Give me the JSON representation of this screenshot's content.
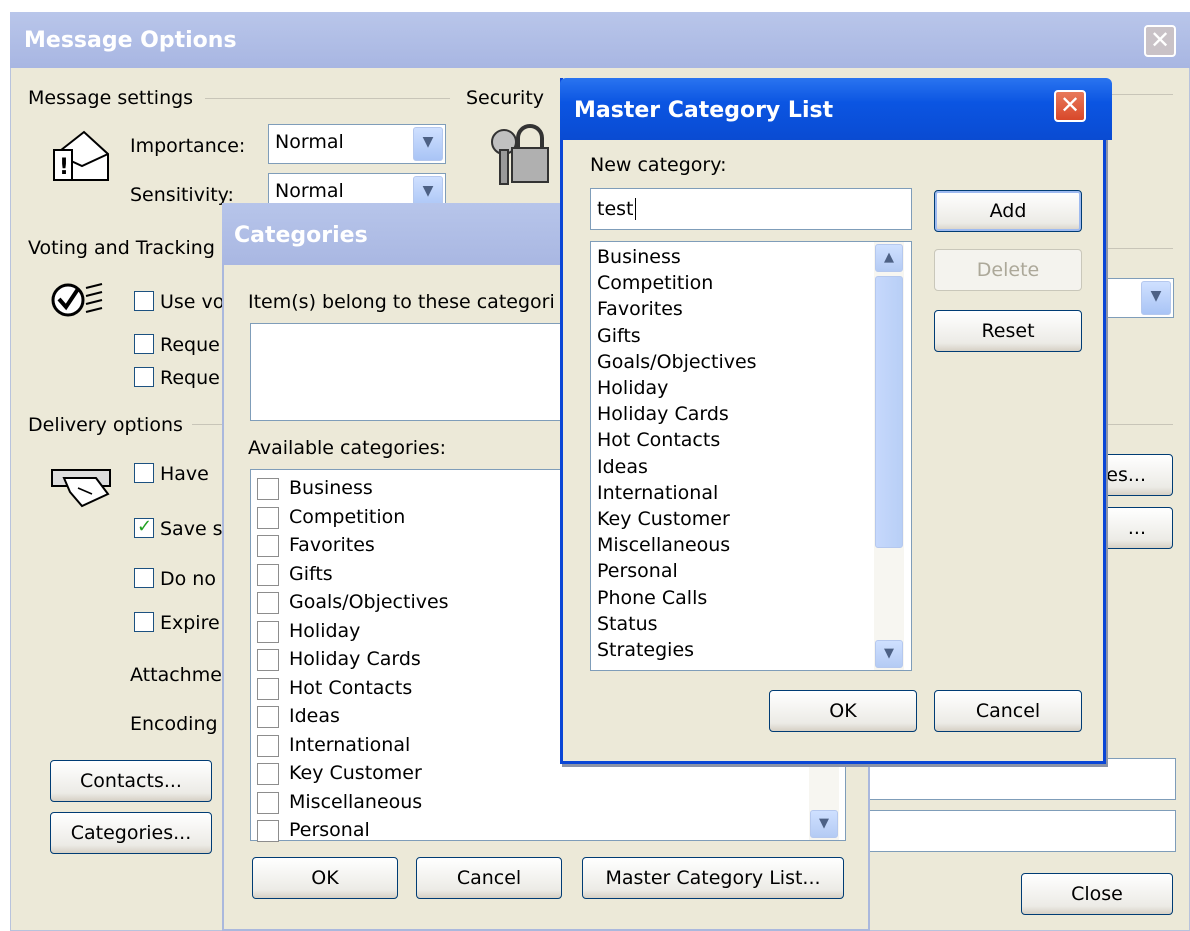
{
  "message_options": {
    "title": "Message Options",
    "message_settings": {
      "legend": "Message settings",
      "importance_label": "Importance:",
      "importance_value": "Normal",
      "sensitivity_label": "Sensitivity:",
      "sensitivity_value": "Normal"
    },
    "security_legend": "Security",
    "voting_legend": "Voting and Tracking",
    "voting_checks": [
      "Use vo",
      "Reque",
      "Reque"
    ],
    "delivery_legend": "Delivery options",
    "delivery_checks": [
      "Have",
      "Save s",
      "Do no",
      "Expire"
    ],
    "attachments_label": "Attachme",
    "encoding_label": "Encoding",
    "contacts_button": "Contacts...",
    "categories_button": "Categories...",
    "partial_button_1": "es...",
    "partial_button_2": "...",
    "close_button": "Close"
  },
  "categories_dialog": {
    "title": "Categories",
    "belongs_label": "Item(s) belong to these categori",
    "available_label": "Available categories:",
    "items": [
      "Business",
      "Competition",
      "Favorites",
      "Gifts",
      "Goals/Objectives",
      "Holiday",
      "Holiday Cards",
      "Hot Contacts",
      "Ideas",
      "International",
      "Key Customer",
      "Miscellaneous",
      "Personal"
    ],
    "ok": "OK",
    "cancel": "Cancel",
    "master_list_button": "Master Category List..."
  },
  "master_dialog": {
    "title": "Master Category List",
    "new_category_label": "New category:",
    "new_category_value": "test",
    "add": "Add",
    "delete": "Delete",
    "reset": "Reset",
    "items": [
      "Business",
      "Competition",
      "Favorites",
      "Gifts",
      "Goals/Objectives",
      "Holiday",
      "Holiday Cards",
      "Hot Contacts",
      "Ideas",
      "International",
      "Key Customer",
      "Miscellaneous",
      "Personal",
      "Phone Calls",
      "Status",
      "Strategies"
    ],
    "ok": "OK",
    "cancel": "Cancel"
  }
}
